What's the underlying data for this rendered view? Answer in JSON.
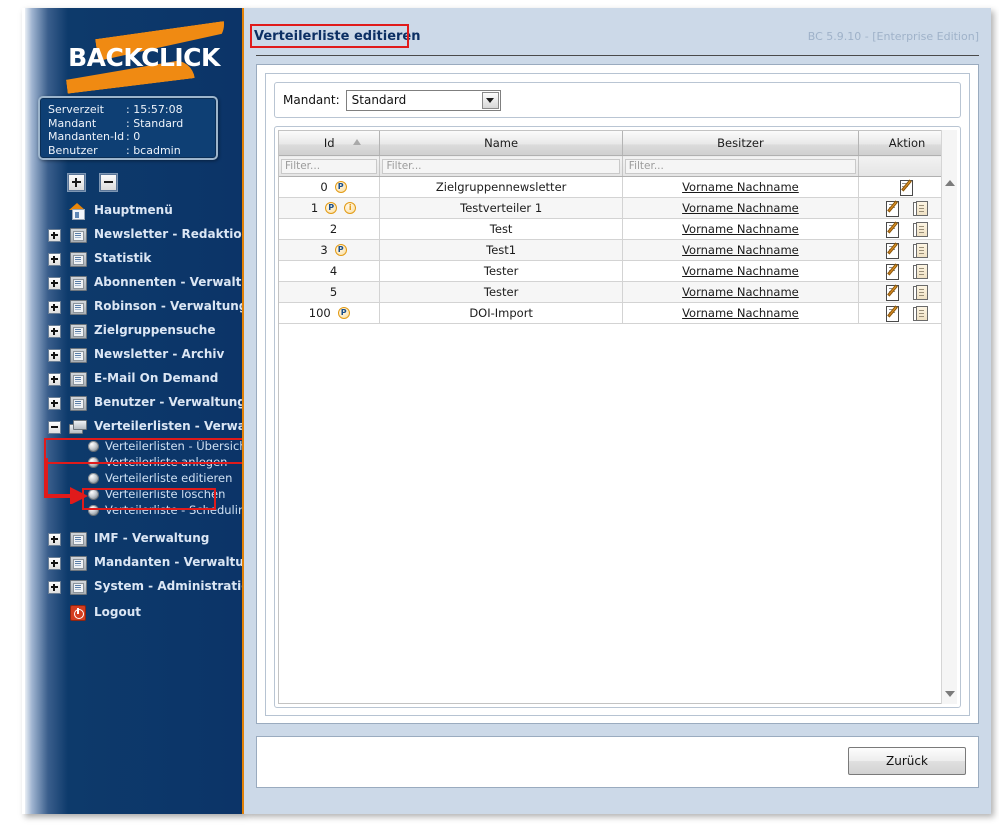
{
  "brand": {
    "logo_text": "BACKCLICK"
  },
  "session": {
    "rows": [
      {
        "label": "Serverzeit",
        "value": "15:57:08"
      },
      {
        "label": "Mandant",
        "value": "Standard"
      },
      {
        "label": "Mandanten-Id",
        "value": "0"
      },
      {
        "label": "Benutzer",
        "value": "bcadmin"
      }
    ]
  },
  "tree_controls": {
    "expand_all": "+",
    "collapse_all": "-"
  },
  "sidebar": {
    "items": [
      {
        "label": "Hauptmenü",
        "icon": "house-icon",
        "expandable": false,
        "expanded": false
      },
      {
        "label": "Newsletter - Redaktion",
        "icon": "folder-icon",
        "expandable": true,
        "expanded": false
      },
      {
        "label": "Statistik",
        "icon": "folder-icon",
        "expandable": true,
        "expanded": false
      },
      {
        "label": "Abonnenten - Verwaltung",
        "icon": "folder-icon",
        "expandable": true,
        "expanded": false
      },
      {
        "label": "Robinson - Verwaltung",
        "icon": "folder-icon",
        "expandable": true,
        "expanded": false
      },
      {
        "label": "Zielgruppensuche",
        "icon": "folder-icon",
        "expandable": true,
        "expanded": false
      },
      {
        "label": "Newsletter - Archiv",
        "icon": "folder-icon",
        "expandable": true,
        "expanded": false
      },
      {
        "label": "E-Mail On Demand",
        "icon": "folder-icon",
        "expandable": true,
        "expanded": false
      },
      {
        "label": "Benutzer - Verwaltung",
        "icon": "folder-icon",
        "expandable": true,
        "expanded": false
      },
      {
        "label": "Verteilerlisten - Verwaltung",
        "icon": "stack-icon",
        "expandable": true,
        "expanded": true
      },
      {
        "label": "IMF - Verwaltung",
        "icon": "folder-icon",
        "expandable": true,
        "expanded": false
      },
      {
        "label": "Mandanten - Verwaltung",
        "icon": "folder-icon",
        "expandable": true,
        "expanded": false
      },
      {
        "label": "System - Administration",
        "icon": "folder-icon",
        "expandable": true,
        "expanded": false
      },
      {
        "label": "Logout",
        "icon": "logout-icon",
        "expandable": false,
        "expanded": false
      }
    ],
    "submenu": [
      {
        "label": "Verteilerlisten - Übersicht",
        "selected": false
      },
      {
        "label": "Verteilerliste anlegen",
        "selected": false
      },
      {
        "label": "Verteilerliste editieren",
        "selected": true
      },
      {
        "label": "Verteilerliste löschen",
        "selected": false
      },
      {
        "label": "Verteilerliste - Scheduling",
        "selected": false
      }
    ]
  },
  "header": {
    "title": "Verteilerliste editieren",
    "version": "BC 5.9.10 - [Enterprise Edition]"
  },
  "mandant": {
    "label": "Mandant:",
    "selected": "Standard",
    "options": [
      "Standard"
    ]
  },
  "grid": {
    "columns": [
      {
        "key": "id",
        "label": "Id",
        "sorted": "asc",
        "filterable": true
      },
      {
        "key": "name",
        "label": "Name",
        "sorted": "",
        "filterable": true
      },
      {
        "key": "owner",
        "label": "Besitzer",
        "sorted": "",
        "filterable": true
      },
      {
        "key": "action",
        "label": "Aktion",
        "sorted": "",
        "filterable": false
      }
    ],
    "filter_placeholder": "Filter...",
    "rows": [
      {
        "id": "0",
        "badges": [
          "P"
        ],
        "name": "Zielgruppennewsletter",
        "owner": "Vorname Nachname",
        "actions": [
          "edit-icon"
        ]
      },
      {
        "id": "1",
        "badges": [
          "P",
          "i"
        ],
        "name": "Testverteiler 1",
        "owner": "Vorname Nachname",
        "actions": [
          "edit-icon",
          "copy-icon"
        ]
      },
      {
        "id": "2",
        "badges": [],
        "name": "Test",
        "owner": "Vorname Nachname",
        "actions": [
          "edit-icon",
          "copy-icon"
        ]
      },
      {
        "id": "3",
        "badges": [
          "P"
        ],
        "name": "Test1",
        "owner": "Vorname Nachname",
        "actions": [
          "edit-icon",
          "copy-icon"
        ]
      },
      {
        "id": "4",
        "badges": [],
        "name": "Tester",
        "owner": "Vorname Nachname",
        "actions": [
          "edit-icon",
          "copy-icon"
        ]
      },
      {
        "id": "5",
        "badges": [],
        "name": "Tester",
        "owner": "Vorname Nachname",
        "actions": [
          "edit-icon",
          "copy-icon"
        ]
      },
      {
        "id": "100",
        "badges": [
          "P"
        ],
        "name": "DOI-Import",
        "owner": "Vorname Nachname",
        "actions": [
          "edit-icon",
          "copy-icon"
        ]
      }
    ]
  },
  "footer": {
    "back_label": "Zurück"
  },
  "colors": {
    "sidebar_bg": "#0c3468",
    "accent_orange": "#e8860a",
    "main_bg": "#ccd9e8",
    "annotation_red": "#e01b1b",
    "title_blue": "#0c2f63"
  }
}
